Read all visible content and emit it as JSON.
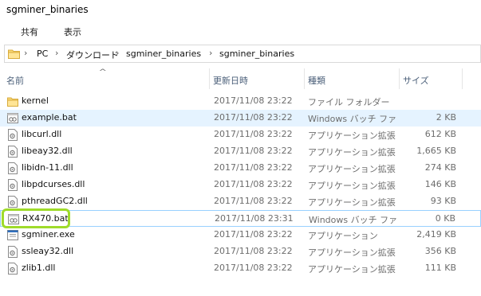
{
  "window": {
    "title": "sgminer_binaries"
  },
  "ribbon": {
    "tabs": [
      {
        "label": "共有"
      },
      {
        "label": "表示"
      }
    ]
  },
  "address": {
    "crumbs": [
      "PC",
      "ダウンロード",
      "sgminer_binaries",
      "sgminer_binaries"
    ]
  },
  "columns": {
    "name": "名前",
    "date": "更新日時",
    "type": "種類",
    "size": "サイズ"
  },
  "files": [
    {
      "name": "kernel",
      "date": "2017/11/08 23:22",
      "type": "ファイル フォルダー",
      "size": "",
      "icon": "folder-icon"
    },
    {
      "name": "example.bat",
      "date": "2017/11/08 23:22",
      "type": "Windows バッチ ファイル",
      "size": "2 KB",
      "icon": "batch-file-icon"
    },
    {
      "name": "libcurl.dll",
      "date": "2017/11/08 23:22",
      "type": "アプリケーション拡張",
      "size": "612 KB",
      "icon": "dll-file-icon"
    },
    {
      "name": "libeay32.dll",
      "date": "2017/11/08 23:22",
      "type": "アプリケーション拡張",
      "size": "1,665 KB",
      "icon": "dll-file-icon"
    },
    {
      "name": "libidn-11.dll",
      "date": "2017/11/08 23:22",
      "type": "アプリケーション拡張",
      "size": "274 KB",
      "icon": "dll-file-icon"
    },
    {
      "name": "libpdcurses.dll",
      "date": "2017/11/08 23:22",
      "type": "アプリケーション拡張",
      "size": "146 KB",
      "icon": "dll-file-icon"
    },
    {
      "name": "pthreadGC2.dll",
      "date": "2017/11/08 23:22",
      "type": "アプリケーション拡張",
      "size": "93 KB",
      "icon": "dll-file-icon"
    },
    {
      "name": "RX470.bat",
      "date": "2017/11/08 23:31",
      "type": "Windows バッチ ファイル",
      "size": "0 KB",
      "icon": "batch-file-icon"
    },
    {
      "name": "sgminer.exe",
      "date": "2017/11/08 23:22",
      "type": "アプリケーション",
      "size": "2,419 KB",
      "icon": "exe-file-icon"
    },
    {
      "name": "ssleay32.dll",
      "date": "2017/11/08 23:22",
      "type": "アプリケーション拡張",
      "size": "356 KB",
      "icon": "dll-file-icon"
    },
    {
      "name": "zlib1.dll",
      "date": "2017/11/08 23:22",
      "type": "アプリケーション拡張",
      "size": "111 KB",
      "icon": "dll-file-icon"
    }
  ],
  "colors": {
    "highlight_ring": "#9fdb2a",
    "hover_row": "#e5f3ff",
    "focus_outline": "#99d1ff",
    "header_text": "#4c607a"
  }
}
